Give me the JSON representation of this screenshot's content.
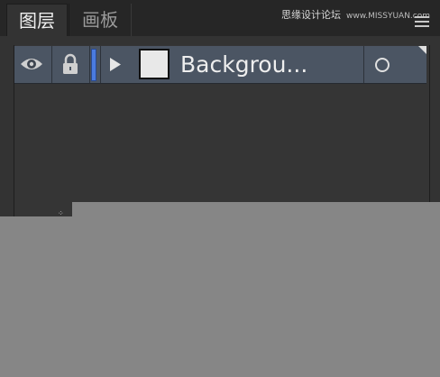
{
  "tabs": [
    {
      "label": "图层",
      "active": true
    },
    {
      "label": "画板",
      "active": false
    }
  ],
  "watermark": {
    "text": "思缘设计论坛",
    "site": "www.MISSYUAN.com"
  },
  "layers": [
    {
      "name": "Backgrou...",
      "visible": true,
      "locked": true,
      "color": "#4a7be0"
    }
  ],
  "icons": {
    "menu": "hamburger-menu-icon",
    "eye": "eye-icon",
    "lock": "lock-icon",
    "expand": "triangle-right-icon",
    "target": "target-circle-icon"
  },
  "colors": {
    "panel_bg": "#333333",
    "tabbar_bg": "#262626",
    "row_selected": "#4b5563",
    "outside_bg": "#868686"
  }
}
